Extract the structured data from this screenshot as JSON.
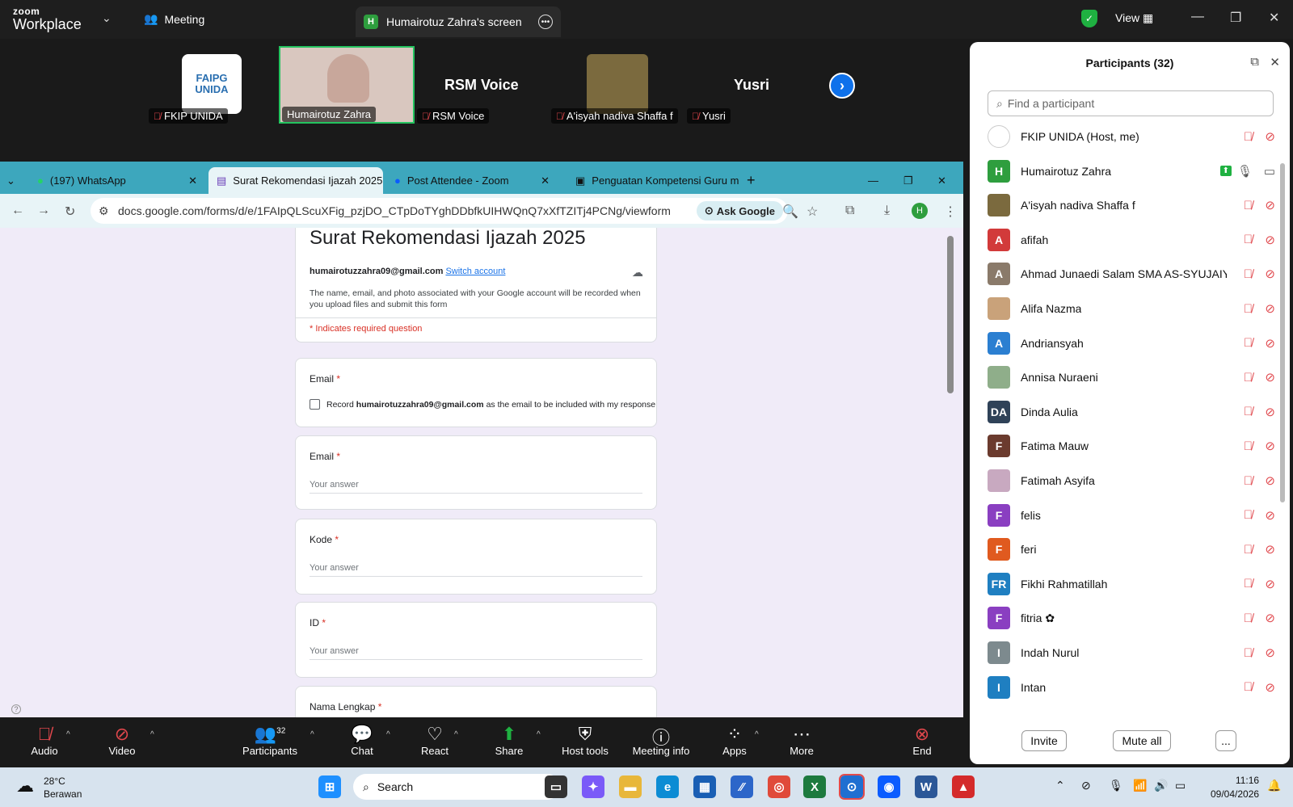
{
  "zoom": {
    "brand_top": "zoom",
    "brand_bottom": "Workplace",
    "meeting_label": "Meeting",
    "share_tab_label": "Humairotuz Zahra's screen",
    "view_label": "View"
  },
  "gallery": {
    "tiles": [
      {
        "name": "FKIP UNIDA",
        "logo_line1": "FAIPG",
        "logo_line2": "UNIDA"
      },
      {
        "name": "Humairotuz Zahra"
      },
      {
        "name": "RSM Voice",
        "big_text": "RSM Voice"
      },
      {
        "name": "A'isyah nadiva Shaffa f"
      },
      {
        "name": "Yusri",
        "big_text": "Yusri"
      }
    ]
  },
  "browser": {
    "tabs": [
      {
        "label": "(197) WhatsApp"
      },
      {
        "label": "Surat Rekomendasi Ijazah 2025"
      },
      {
        "label": "Post Attendee - Zoom"
      },
      {
        "label": "Penguatan Kompetensi Guru m"
      }
    ],
    "url": "docs.google.com/forms/d/e/1FAIpQLScuXFig_pzjDO_CTpDoTYghDDbfkUIHWQnQ7xXfTZITj4PCNg/viewform",
    "ask_google": "Ask Google",
    "profile_initial": "H"
  },
  "form": {
    "title": "Surat Rekomendasi Ijazah 2025",
    "account_email": "humairotuzzahra09@gmail.com",
    "switch_account": "Switch account",
    "notice": "The name, email, and photo associated with your Google account will be recorded when you upload files and submit this form",
    "required_note": "* Indicates required question",
    "q1_label": "Email",
    "q1_checkbox_prefix": "Record",
    "q1_checkbox_email": "humairotuzzahra09@gmail.com",
    "q1_checkbox_suffix": "as the email to be included with my response",
    "q2_label": "Email",
    "q3_label": "Kode",
    "q4_label": "ID",
    "q5_label": "Nama Lengkap",
    "answer_placeholder": "Your answer",
    "asterisk": "*"
  },
  "participants": {
    "title": "Participants (32)",
    "search_placeholder": "Find a participant",
    "list": [
      {
        "name": "FKIP UNIDA (Host, me)",
        "initials": "",
        "color": "#ffffff"
      },
      {
        "name": "Humairotuz Zahra",
        "initials": "H",
        "color": "#2e9e3e"
      },
      {
        "name": "A'isyah nadiva Shaffa f",
        "initials": "",
        "color": "#7b6a3e"
      },
      {
        "name": "afifah",
        "initials": "A",
        "color": "#d23a3a"
      },
      {
        "name": "Ahmad Junaedi Salam SMA AS-SYUJAIYAH",
        "initials": "A",
        "color": "#8a7a6a"
      },
      {
        "name": "Alifa Nazma",
        "initials": "",
        "color": "#c9a27a"
      },
      {
        "name": "Andriansyah",
        "initials": "A",
        "color": "#2b7fd1"
      },
      {
        "name": "Annisa Nuraeni",
        "initials": "",
        "color": "#8fae8a"
      },
      {
        "name": "Dinda Aulia",
        "initials": "DA",
        "color": "#2f4258"
      },
      {
        "name": "Fatima Mauw",
        "initials": "F",
        "color": "#6b3b2e"
      },
      {
        "name": "Fatimah Asyifa",
        "initials": "",
        "color": "#c8a9c0"
      },
      {
        "name": "felis",
        "initials": "F",
        "color": "#8a3fc1"
      },
      {
        "name": "feri",
        "initials": "F",
        "color": "#e05a1f"
      },
      {
        "name": "Fikhi Rahmatillah",
        "initials": "FR",
        "color": "#1f7fc1"
      },
      {
        "name": "fitria ✿",
        "initials": "F",
        "color": "#8a3fc1"
      },
      {
        "name": "Indah Nurul",
        "initials": "I",
        "color": "#7d8a8e"
      },
      {
        "name": "Intan",
        "initials": "I",
        "color": "#1f7fc1"
      }
    ],
    "invite": "Invite",
    "mute_all": "Mute all",
    "more": "..."
  },
  "toolbar": {
    "audio": "Audio",
    "video": "Video",
    "participants": "Participants",
    "participants_count": "32",
    "chat": "Chat",
    "react": "React",
    "share": "Share",
    "host_tools": "Host tools",
    "meeting_info": "Meeting info",
    "apps": "Apps",
    "more": "More",
    "end": "End"
  },
  "taskbar": {
    "weather_temp": "28°C",
    "weather_desc": "Berawan",
    "search": "Search",
    "time": "11:16",
    "date": "09/04/2026"
  }
}
